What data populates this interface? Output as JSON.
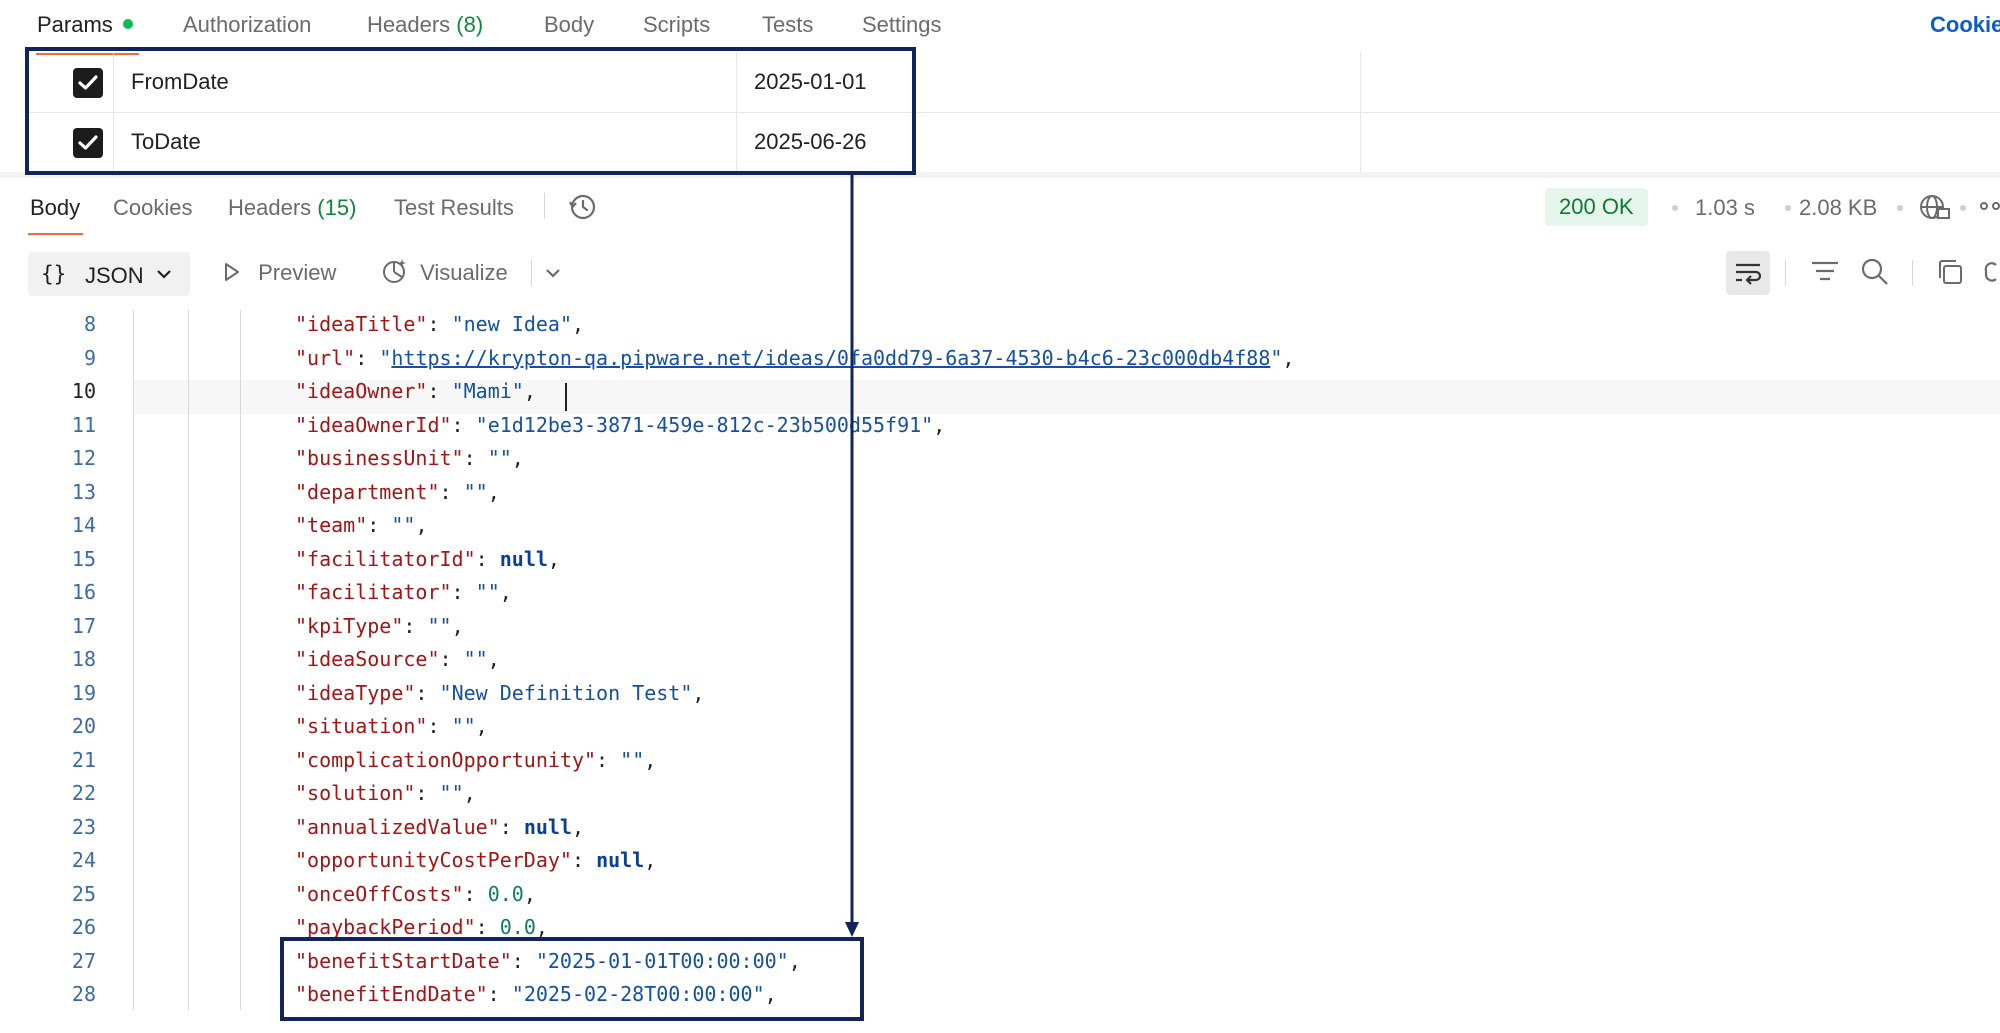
{
  "request_tabs": {
    "params": "Params",
    "authorization": "Authorization",
    "headers": "Headers",
    "headers_count": "(8)",
    "body": "Body",
    "scripts": "Scripts",
    "tests": "Tests",
    "settings": "Settings",
    "cookies_link": "Cookie"
  },
  "params": [
    {
      "key": "FromDate",
      "value": "2025-01-01",
      "checked": true
    },
    {
      "key": "ToDate",
      "value": "2025-06-26",
      "checked": true
    }
  ],
  "response_tabs": {
    "body": "Body",
    "cookies": "Cookies",
    "headers": "Headers",
    "headers_count": "(15)",
    "test_results": "Test Results"
  },
  "response_meta": {
    "status": "200 OK",
    "time": "1.03 s",
    "size": "2.08 KB"
  },
  "toolbar": {
    "format": "JSON",
    "preview": "Preview",
    "visualize": "Visualize"
  },
  "code": {
    "line_numbers": [
      "8",
      "9",
      "10",
      "11",
      "12",
      "13",
      "14",
      "15",
      "16",
      "17",
      "18",
      "19",
      "20",
      "21",
      "22",
      "23",
      "24",
      "25",
      "26",
      "27",
      "28"
    ],
    "current_line": "10",
    "lines": [
      {
        "key": "ideaTitle",
        "value": "new Idea",
        "type": "string"
      },
      {
        "key": "url",
        "value": "https://krypton-qa.pipware.net/ideas/0fa0dd79-6a37-4530-b4c6-23c000db4f88",
        "type": "url"
      },
      {
        "key": "ideaOwner",
        "value": "Mami",
        "type": "string"
      },
      {
        "key": "ideaOwnerId",
        "value": "e1d12be3-3871-459e-812c-23b500d55f91",
        "type": "string"
      },
      {
        "key": "businessUnit",
        "value": "",
        "type": "string"
      },
      {
        "key": "department",
        "value": "",
        "type": "string"
      },
      {
        "key": "team",
        "value": "",
        "type": "string"
      },
      {
        "key": "facilitatorId",
        "value": "null",
        "type": "null"
      },
      {
        "key": "facilitator",
        "value": "",
        "type": "string"
      },
      {
        "key": "kpiType",
        "value": "",
        "type": "string"
      },
      {
        "key": "ideaSource",
        "value": "",
        "type": "string"
      },
      {
        "key": "ideaType",
        "value": "New Definition Test",
        "type": "string"
      },
      {
        "key": "situation",
        "value": "",
        "type": "string"
      },
      {
        "key": "complicationOpportunity",
        "value": "",
        "type": "string"
      },
      {
        "key": "solution",
        "value": "",
        "type": "string"
      },
      {
        "key": "annualizedValue",
        "value": "null",
        "type": "null"
      },
      {
        "key": "opportunityCostPerDay",
        "value": "null",
        "type": "null"
      },
      {
        "key": "onceOffCosts",
        "value": "0.0",
        "type": "number"
      },
      {
        "key": "paybackPeriod",
        "value": "0.0",
        "type": "number"
      },
      {
        "key": "benefitStartDate",
        "value": "2025-01-01T00:00:00",
        "type": "string"
      },
      {
        "key": "benefitEndDate",
        "value": "2025-02-28T00:00:00",
        "type": "string"
      }
    ]
  },
  "colors": {
    "accent": "#f26b3a",
    "highlight_border": "#13235b",
    "status_bg": "#e7f6ec",
    "status_fg": "#0c7a32",
    "json_key": "#a31515",
    "json_string": "#1450a3"
  }
}
